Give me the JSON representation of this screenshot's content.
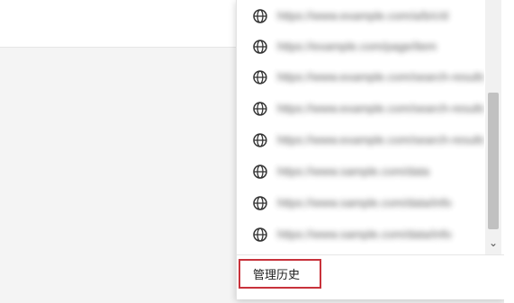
{
  "history_dropdown": {
    "items": [
      {
        "label": "https://www.example.com/a/b/c/d"
      },
      {
        "label": "https://example.com/page/item"
      },
      {
        "label": "https://www.example.com/search-results"
      },
      {
        "label": "https://www.example.com/search-results"
      },
      {
        "label": "https://www.example.com/search-results"
      },
      {
        "label": "https://www.sample.com/data"
      },
      {
        "label": "https://www.sample.com/data/info"
      },
      {
        "label": "https://www.sample.com/data/info"
      }
    ],
    "manage_label": "管理历史",
    "scroll_down_glyph": "⌄"
  }
}
